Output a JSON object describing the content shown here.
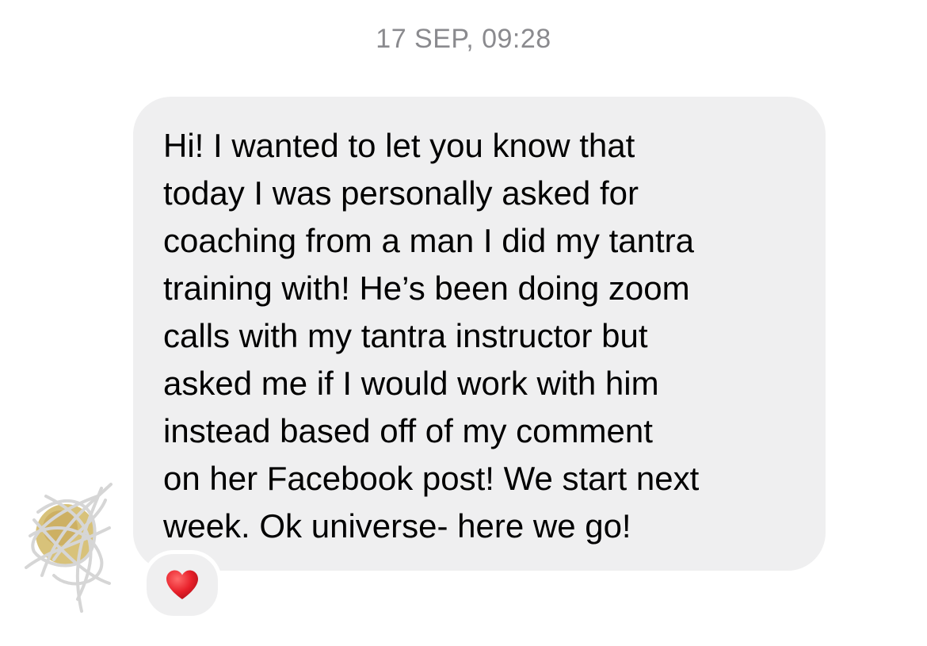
{
  "conversation": {
    "timestamp": "17 SEP, 09:28"
  },
  "message": {
    "text": "Hi! I wanted to let you know that\ntoday I was personally asked for\ncoaching from a man I did my tantra\ntraining with! He’s been doing zoom\ncalls with my tantra instructor but\nasked me if I would work with him\ninstead based off of my comment\non her Facebook post! We start next\nweek. Ok universe- here we go!",
    "bubble_color": "#efeff0",
    "text_color": "#000000"
  },
  "sender": {
    "avatar_icon": "scribbled-out-avatar-icon"
  },
  "reaction": {
    "icon": "red-heart-icon",
    "color": "#e8202a"
  }
}
